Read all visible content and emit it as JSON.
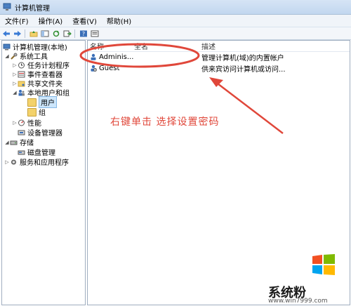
{
  "window": {
    "title": "计算机管理"
  },
  "menu": [
    "文件(F)",
    "操作(A)",
    "查看(V)",
    "帮助(H)"
  ],
  "toolbar": {
    "icons": [
      "back-icon",
      "forward-icon",
      "up-folder-icon",
      "show-hide-tree-icon",
      "refresh-icon",
      "export-icon",
      "help-icon",
      "properties-icon"
    ]
  },
  "tree": {
    "root": "计算机管理(本地)",
    "system_tools": "系统工具",
    "task_scheduler": "任务计划程序",
    "event_viewer": "事件查看器",
    "shared_folders": "共享文件夹",
    "local_users_groups": "本地用户和组",
    "users": "用户",
    "groups": "组",
    "performance": "性能",
    "device_manager": "设备管理器",
    "storage": "存储",
    "disk_management": "磁盘管理",
    "services_apps": "服务和应用程序"
  },
  "list": {
    "columns": {
      "name": "名称",
      "fullname": "全名",
      "description": "描述"
    },
    "rows": [
      {
        "name": "Adminis...",
        "fullname": "",
        "description": "管理计算机(域)的内置帐户"
      },
      {
        "name": "Guest",
        "fullname": "",
        "description": "供来宾访问计算机或访问..."
      }
    ]
  },
  "annotation": {
    "text": "右键单击 选择设置密码",
    "color": "#e0473a"
  },
  "watermark": {
    "brand": "系统粉",
    "url": "www.win7999.com"
  }
}
